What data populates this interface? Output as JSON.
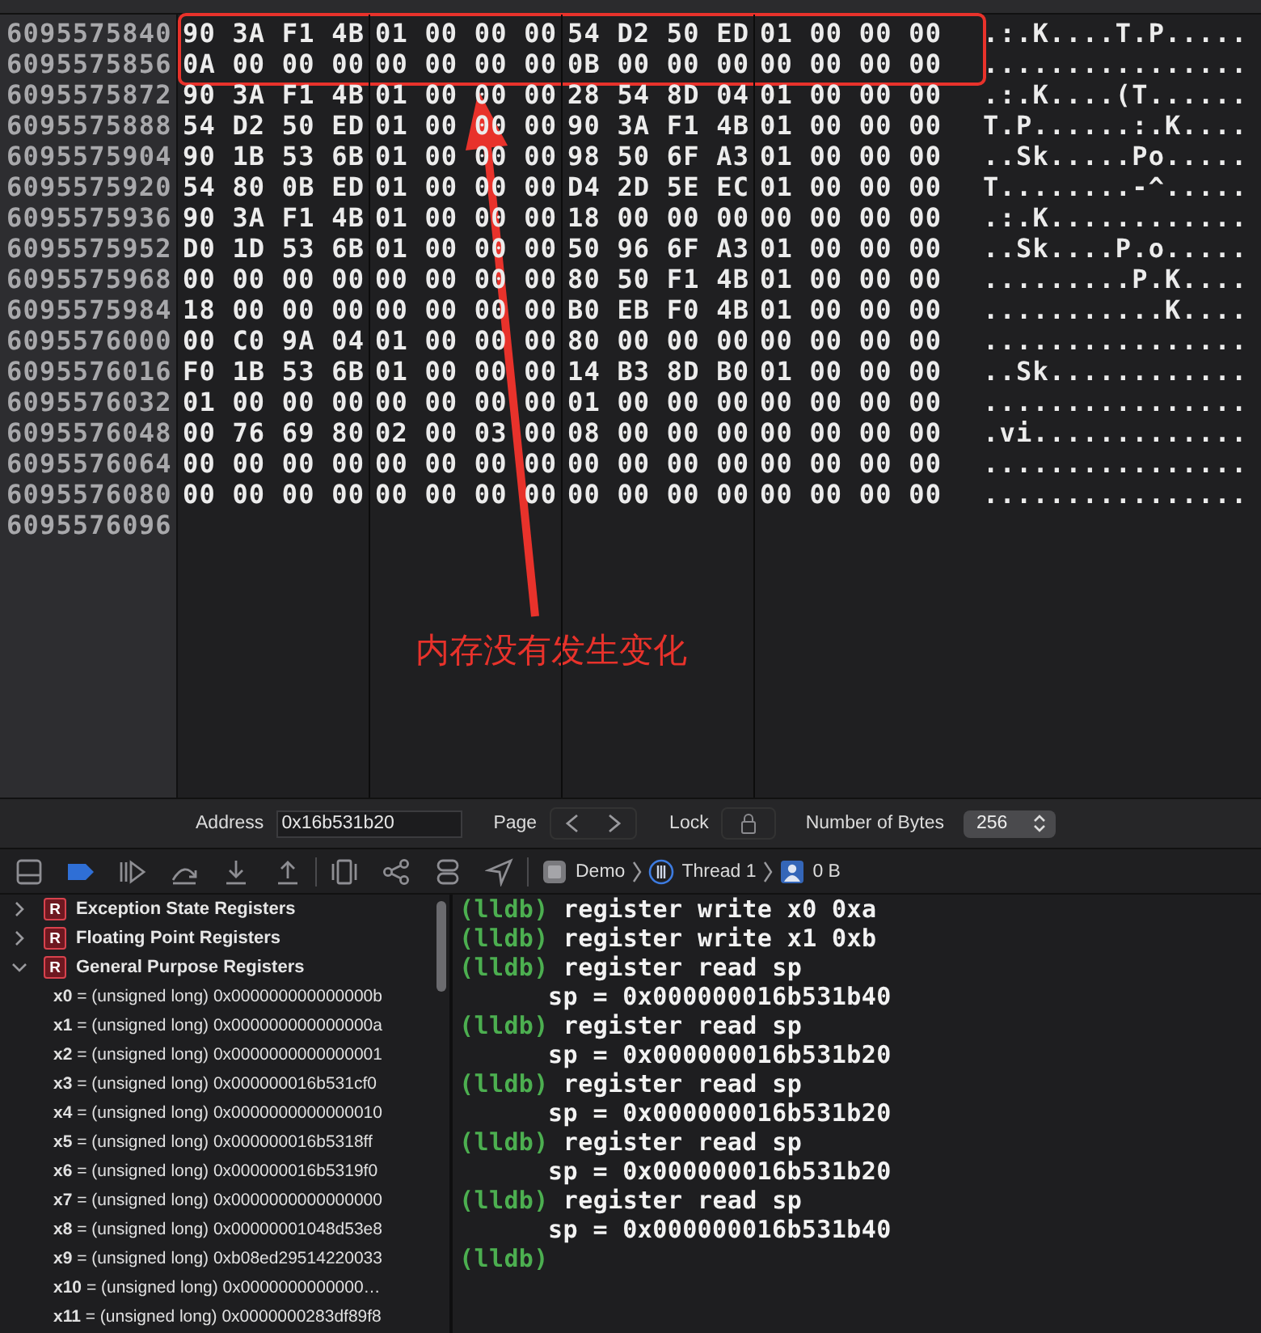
{
  "memory": {
    "rows": [
      {
        "address": "6095575840",
        "groups": [
          "90 3A F1 4B",
          "01 00 00 00",
          "54 D2 50 ED",
          "01 00 00 00"
        ],
        "ascii": ".:.K....T.P....."
      },
      {
        "address": "6095575856",
        "groups": [
          "0A 00 00 00",
          "00 00 00 00",
          "0B 00 00 00",
          "00 00 00 00"
        ],
        "ascii": "................"
      },
      {
        "address": "6095575872",
        "groups": [
          "90 3A F1 4B",
          "01 00 00 00",
          "28 54 8D 04",
          "01 00 00 00"
        ],
        "ascii": ".:.K....(T......"
      },
      {
        "address": "6095575888",
        "groups": [
          "54 D2 50 ED",
          "01 00 00 00",
          "90 3A F1 4B",
          "01 00 00 00"
        ],
        "ascii": "T.P......:.K...."
      },
      {
        "address": "6095575904",
        "groups": [
          "90 1B 53 6B",
          "01 00 00 00",
          "98 50 6F A3",
          "01 00 00 00"
        ],
        "ascii": "..Sk.....Po....."
      },
      {
        "address": "6095575920",
        "groups": [
          "54 80 0B ED",
          "01 00 00 00",
          "D4 2D 5E EC",
          "01 00 00 00"
        ],
        "ascii": "T........-^....."
      },
      {
        "address": "6095575936",
        "groups": [
          "90 3A F1 4B",
          "01 00 00 00",
          "18 00 00 00",
          "00 00 00 00"
        ],
        "ascii": ".:.K............"
      },
      {
        "address": "6095575952",
        "groups": [
          "D0 1D 53 6B",
          "01 00 00 00",
          "50 96 6F A3",
          "01 00 00 00"
        ],
        "ascii": "..Sk....P.o....."
      },
      {
        "address": "6095575968",
        "groups": [
          "00 00 00 00",
          "00 00 00 00",
          "80 50 F1 4B",
          "01 00 00 00"
        ],
        "ascii": ".........P.K...."
      },
      {
        "address": "6095575984",
        "groups": [
          "18 00 00 00",
          "00 00 00 00",
          "B0 EB F0 4B",
          "01 00 00 00"
        ],
        "ascii": "...........K...."
      },
      {
        "address": "6095576000",
        "groups": [
          "00 C0 9A 04",
          "01 00 00 00",
          "80 00 00 00",
          "00 00 00 00"
        ],
        "ascii": "................"
      },
      {
        "address": "6095576016",
        "groups": [
          "F0 1B 53 6B",
          "01 00 00 00",
          "14 B3 8D B0",
          "01 00 00 00"
        ],
        "ascii": "..Sk............"
      },
      {
        "address": "6095576032",
        "groups": [
          "01 00 00 00",
          "00 00 00 00",
          "01 00 00 00",
          "00 00 00 00"
        ],
        "ascii": "................"
      },
      {
        "address": "6095576048",
        "groups": [
          "00 76 69 80",
          "02 00 03 00",
          "08 00 00 00",
          "00 00 00 00"
        ],
        "ascii": ".vi............."
      },
      {
        "address": "6095576064",
        "groups": [
          "00 00 00 00",
          "00 00 00 00",
          "00 00 00 00",
          "00 00 00 00"
        ],
        "ascii": "................"
      },
      {
        "address": "6095576080",
        "groups": [
          "00 00 00 00",
          "00 00 00 00",
          "00 00 00 00",
          "00 00 00 00"
        ],
        "ascii": "................"
      },
      {
        "address": "6095576096"
      }
    ]
  },
  "annotation": {
    "text": "内存没有发生变化"
  },
  "memory_bar": {
    "address_label": "Address",
    "address": "0x16b531b20",
    "page_label": "Page",
    "lock_label": "Lock",
    "bytes_label": "Number of Bytes",
    "bytes": "256"
  },
  "debug_bar": {
    "breakpoints_active": true,
    "breadcrumbs": [
      {
        "kind": "app",
        "label": "Demo"
      },
      {
        "kind": "thread",
        "label": "Thread 1"
      },
      {
        "kind": "frame",
        "label": "0 B"
      }
    ]
  },
  "variables": [
    {
      "badge": "R",
      "label": "Exception State Registers",
      "expanded": false
    },
    {
      "badge": "R",
      "label": "Floating Point Registers",
      "expanded": false
    },
    {
      "badge": "R",
      "label": "General Purpose Registers",
      "expanded": true,
      "children": [
        {
          "text": "**x0** = (unsigned long) 0x000000000000000b"
        },
        {
          "text": "**x1** = (unsigned long) 0x000000000000000a"
        },
        {
          "text": "**x2** = (unsigned long) 0x0000000000000001"
        },
        {
          "text": "**x3** = (unsigned long) 0x000000016b531cf0"
        },
        {
          "text": "**x4** = (unsigned long) 0x0000000000000010"
        },
        {
          "text": "**x5** = (unsigned long) 0x000000016b5318ff"
        },
        {
          "text": "**x6** = (unsigned long) 0x000000016b5319f0"
        },
        {
          "text": "**x7** = (unsigned long) 0x0000000000000000"
        },
        {
          "text": "**x8** = (unsigned long) 0x00000001048d53e8"
        },
        {
          "text": "**x9** = (unsigned long) 0xb08ed29514220033"
        },
        {
          "text": "**x10** = (unsigned long) 0x0000000000000…"
        },
        {
          "text": "**x11** = (unsigned long) 0x0000000283df89f8"
        }
      ]
    }
  ],
  "console": [
    {
      "kind": "command",
      "prompt": "(lldb)",
      "text": "register write x0 0xa"
    },
    {
      "kind": "command",
      "prompt": "(lldb)",
      "text": "register write x1 0xb"
    },
    {
      "kind": "command",
      "prompt": "(lldb)",
      "text": "register read sp"
    },
    {
      "kind": "output",
      "text": "sp = 0x000000016b531b40"
    },
    {
      "kind": "command",
      "prompt": "(lldb)",
      "text": "register read sp"
    },
    {
      "kind": "output",
      "text": "sp = 0x000000016b531b20"
    },
    {
      "kind": "command",
      "prompt": "(lldb)",
      "text": "register read sp"
    },
    {
      "kind": "output",
      "text": "sp = 0x000000016b531b20"
    },
    {
      "kind": "command",
      "prompt": "(lldb)",
      "text": "register read sp"
    },
    {
      "kind": "output",
      "text": "sp = 0x000000016b531b20"
    },
    {
      "kind": "command",
      "prompt": "(lldb)",
      "text": "register read sp"
    },
    {
      "kind": "output",
      "text": "sp = 0x000000016b531b40"
    },
    {
      "kind": "command",
      "prompt": "(lldb)"
    }
  ]
}
